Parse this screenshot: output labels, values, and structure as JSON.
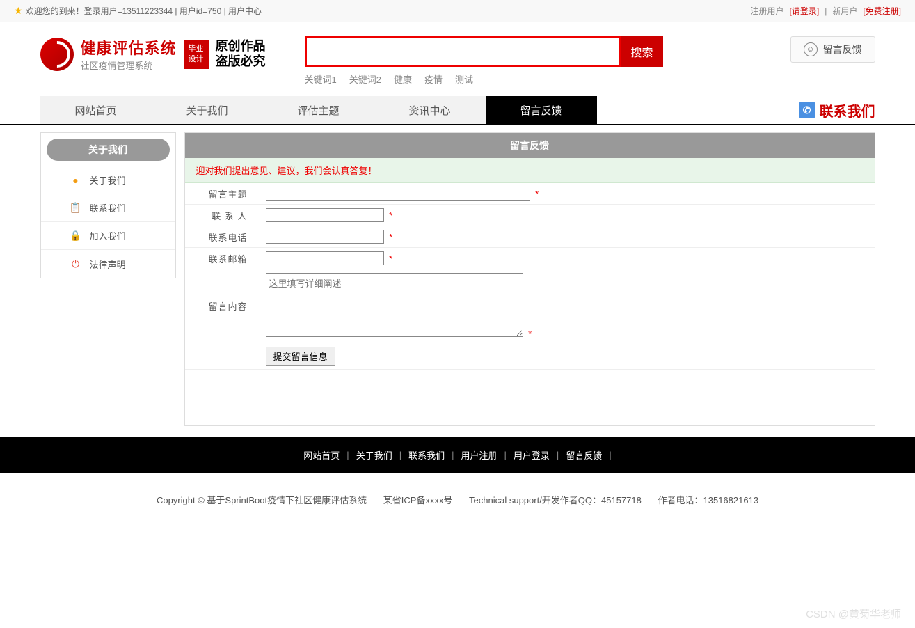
{
  "topbar": {
    "welcome": "欢迎您的到来！登录用户=13511223344 | 用户id=750 | 用户中心",
    "reg_label": "注册用户",
    "login_link": "[请登录]",
    "new_label": "新用户",
    "free_reg_link": "[免费注册]"
  },
  "logo": {
    "title": "健康评估系统",
    "subtitle": "社区疫情管理系统",
    "badge_line1": "毕业",
    "badge_line2": "设计",
    "calligraphy_line1": "原创作品",
    "calligraphy_line2": "盗版必究"
  },
  "search": {
    "button": "搜索",
    "keywords": [
      "关键词1",
      "关键词2",
      "健康",
      "疫情",
      "测试"
    ]
  },
  "feedback_button": "留言反馈",
  "nav": {
    "items": [
      "网站首页",
      "关于我们",
      "评估主题",
      "资讯中心",
      "留言反馈"
    ],
    "active_index": 4,
    "contact": "联系我们"
  },
  "sidebar": {
    "title": "关于我们",
    "items": [
      {
        "label": "关于我们",
        "icon": "info-icon",
        "color": "ic-orange",
        "glyph": "●"
      },
      {
        "label": "联系我们",
        "icon": "clipboard-icon",
        "color": "ic-blue",
        "glyph": "📋"
      },
      {
        "label": "加入我们",
        "icon": "lock-icon",
        "color": "ic-red",
        "glyph": "🔒"
      },
      {
        "label": "法律声明",
        "icon": "power-icon",
        "color": "ic-red",
        "glyph": "⏻"
      }
    ]
  },
  "panel": {
    "title": "留言反馈",
    "notice": "迎对我们提出意见、建议，我们会认真答复！",
    "labels": {
      "subject": "留言主题",
      "contact": "联 系 人",
      "phone": "联系电话",
      "email": "联系邮箱",
      "content": "留言内容"
    },
    "textarea_placeholder": "这里填写详细阐述",
    "submit": "提交留言信息",
    "required": "*"
  },
  "footer": {
    "links": [
      "网站首页",
      "关于我们",
      "联系我们",
      "用户注册",
      "用户登录",
      "留言反馈"
    ],
    "copyright_prefix": "Copyright © 基于SprintBoot疫情下社区健康评估系统",
    "icp": "某省ICP备xxxx号",
    "support": "Technical support/开发作者QQ：45157718",
    "author_phone": "作者电话：13516821613"
  },
  "watermark": "CSDN @黄菊华老师"
}
